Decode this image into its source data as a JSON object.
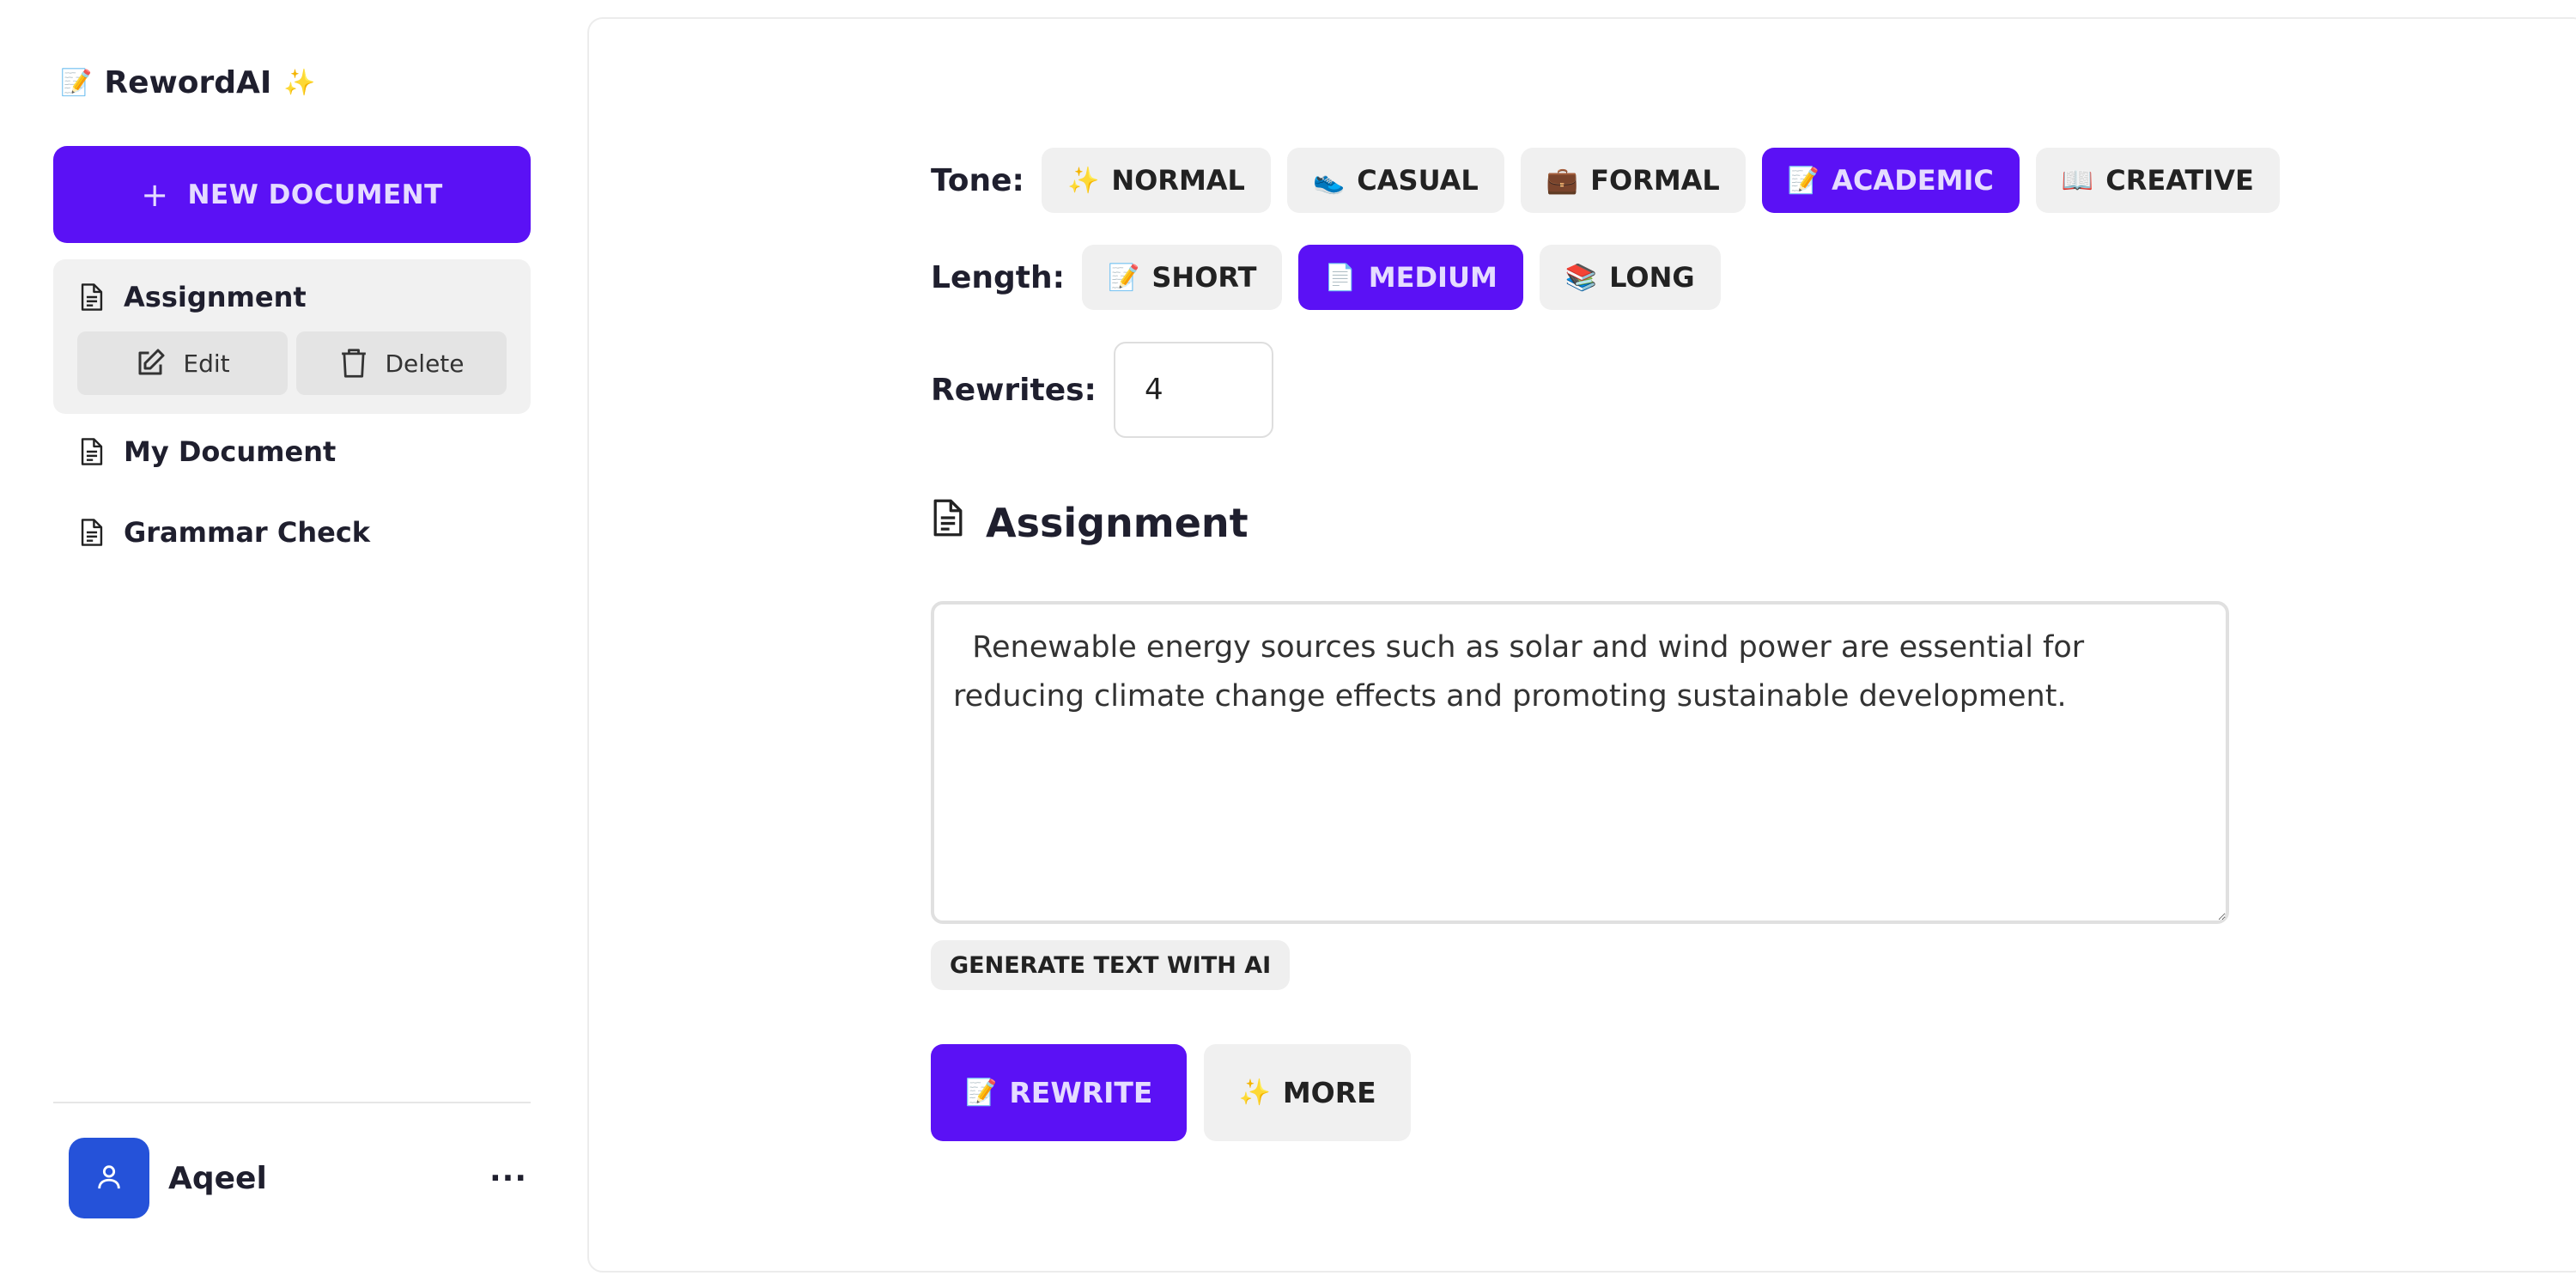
{
  "app": {
    "name": "RewordAI",
    "logo_icon": "📝",
    "logo_sparkle": "✨"
  },
  "sidebar": {
    "new_document_label": "NEW DOCUMENT",
    "documents": [
      {
        "title": "Assignment",
        "active": true
      },
      {
        "title": "My Document",
        "active": false
      },
      {
        "title": "Grammar Check",
        "active": false
      }
    ],
    "edit_label": "Edit",
    "delete_label": "Delete"
  },
  "user": {
    "name": "Aqeel",
    "menu_label": "···"
  },
  "tone": {
    "label": "Tone:",
    "options": [
      {
        "icon": "✨",
        "label": "NORMAL"
      },
      {
        "icon": "👟",
        "label": "CASUAL"
      },
      {
        "icon": "💼",
        "label": "FORMAL"
      },
      {
        "icon": "📝",
        "label": "ACADEMIC"
      },
      {
        "icon": "📖",
        "label": "CREATIVE"
      }
    ],
    "selected": "ACADEMIC"
  },
  "length": {
    "label": "Length:",
    "options": [
      {
        "icon": "📝",
        "label": "SHORT"
      },
      {
        "icon": "📄",
        "label": "MEDIUM"
      },
      {
        "icon": "📚",
        "label": "LONG"
      }
    ],
    "selected": "MEDIUM"
  },
  "rewrites": {
    "label": "Rewrites:",
    "value": "4"
  },
  "document": {
    "title": "Assignment",
    "text": "  Renewable energy sources such as solar and wind power are essential for reducing climate change effects and promoting sustainable development."
  },
  "generate_label": "GENERATE TEXT WITH AI",
  "actions": {
    "rewrite_icon": "📝",
    "rewrite_label": "REWRITE",
    "more_icon": "✨",
    "more_label": "MORE"
  },
  "colors": {
    "accent": "#5b11f5",
    "accent_text": "#e5dcff",
    "avatar": "#2552d9",
    "chip_bg": "#f0f0f0"
  }
}
